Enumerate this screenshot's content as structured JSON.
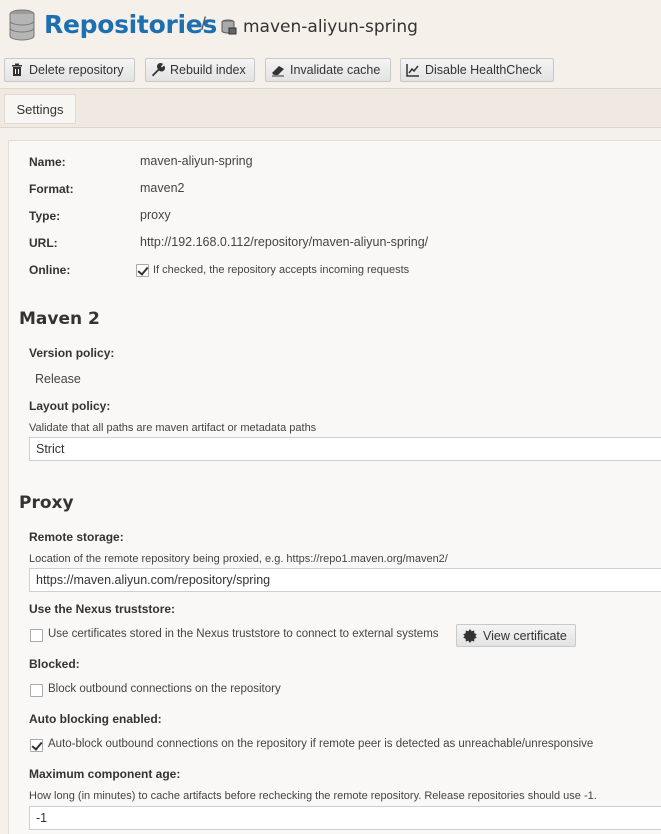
{
  "header": {
    "title": "Repositories",
    "separator": "/",
    "repo_name": "maven-aliyun-spring"
  },
  "toolbar": {
    "delete": "Delete repository",
    "rebuild": "Rebuild index",
    "invalidate": "Invalidate cache",
    "healthcheck": "Disable HealthCheck"
  },
  "tabs": {
    "settings": "Settings"
  },
  "summary": {
    "name_label": "Name:",
    "name_value": "maven-aliyun-spring",
    "format_label": "Format:",
    "format_value": "maven2",
    "type_label": "Type:",
    "type_value": "proxy",
    "url_label": "URL:",
    "url_value": "http://192.168.0.112/repository/maven-aliyun-spring/",
    "online_label": "Online:",
    "online_text": "If checked, the repository accepts incoming requests",
    "online_checked": true
  },
  "maven2": {
    "heading": "Maven 2",
    "version_label": "Version policy:",
    "version_value": "Release",
    "layout_label": "Layout policy:",
    "layout_help": "Validate that all paths are maven artifact or metadata paths",
    "layout_value": "Strict"
  },
  "proxy": {
    "heading": "Proxy",
    "remote_label": "Remote storage:",
    "remote_help": "Location of the remote repository being proxied, e.g. https://repo1.maven.org/maven2/",
    "remote_value": "https://maven.aliyun.com/repository/spring",
    "truststore_label": "Use the Nexus truststore:",
    "truststore_text": "Use certificates stored in the Nexus truststore to connect to external systems",
    "truststore_checked": false,
    "view_cert": "View certificate",
    "blocked_label": "Blocked:",
    "blocked_text": "Block outbound connections on the repository",
    "blocked_checked": false,
    "autoblock_label": "Auto blocking enabled:",
    "autoblock_text": "Auto-block outbound connections on the repository if remote peer is detected as unreachable/unresponsive",
    "autoblock_checked": true,
    "maxage_label": "Maximum component age:",
    "maxage_help": "How long (in minutes) to cache artifacts before rechecking the remote repository. Release repositories should use -1.",
    "maxage_value": "-1"
  }
}
